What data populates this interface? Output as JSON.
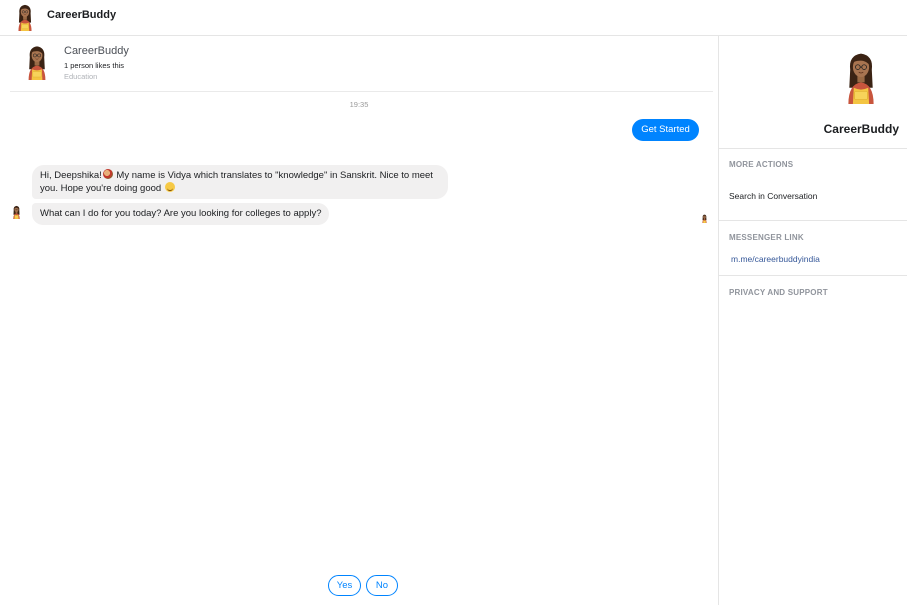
{
  "app": {
    "title": "CareerBuddy"
  },
  "profile": {
    "name": "CareerBuddy",
    "likes": "1 person likes this",
    "category": "Education"
  },
  "conversation": {
    "timestamp": "19:35",
    "sent_button": "Get Started",
    "messages": [
      {
        "text_part1": "Hi, Deepshika!",
        "text_part2": " My name is Vidya which translates to \"knowledge\" in Sanskrit. Nice to meet you. Hope you're doing good "
      },
      {
        "text": "What can I do for you today? Are you looking for colleges to apply?"
      }
    ],
    "quick_replies": [
      "Yes",
      "No"
    ]
  },
  "sidebar": {
    "name": "CareerBuddy",
    "more_actions_heading": "MORE ACTIONS",
    "search_item": "Search in Conversation",
    "messenger_link_heading": "MESSENGER LINK",
    "messenger_link": "m.me/careerbuddyindia",
    "privacy_heading": "PRIVACY AND SUPPORT"
  },
  "colors": {
    "accent": "#0084ff",
    "bubble": "#f1f0f0",
    "link": "#365899"
  },
  "icons": {
    "avatar": "girl-avatar-icon",
    "emoji_1": "globe-face-emoji-icon",
    "emoji_2": "smile-emoji-icon"
  }
}
